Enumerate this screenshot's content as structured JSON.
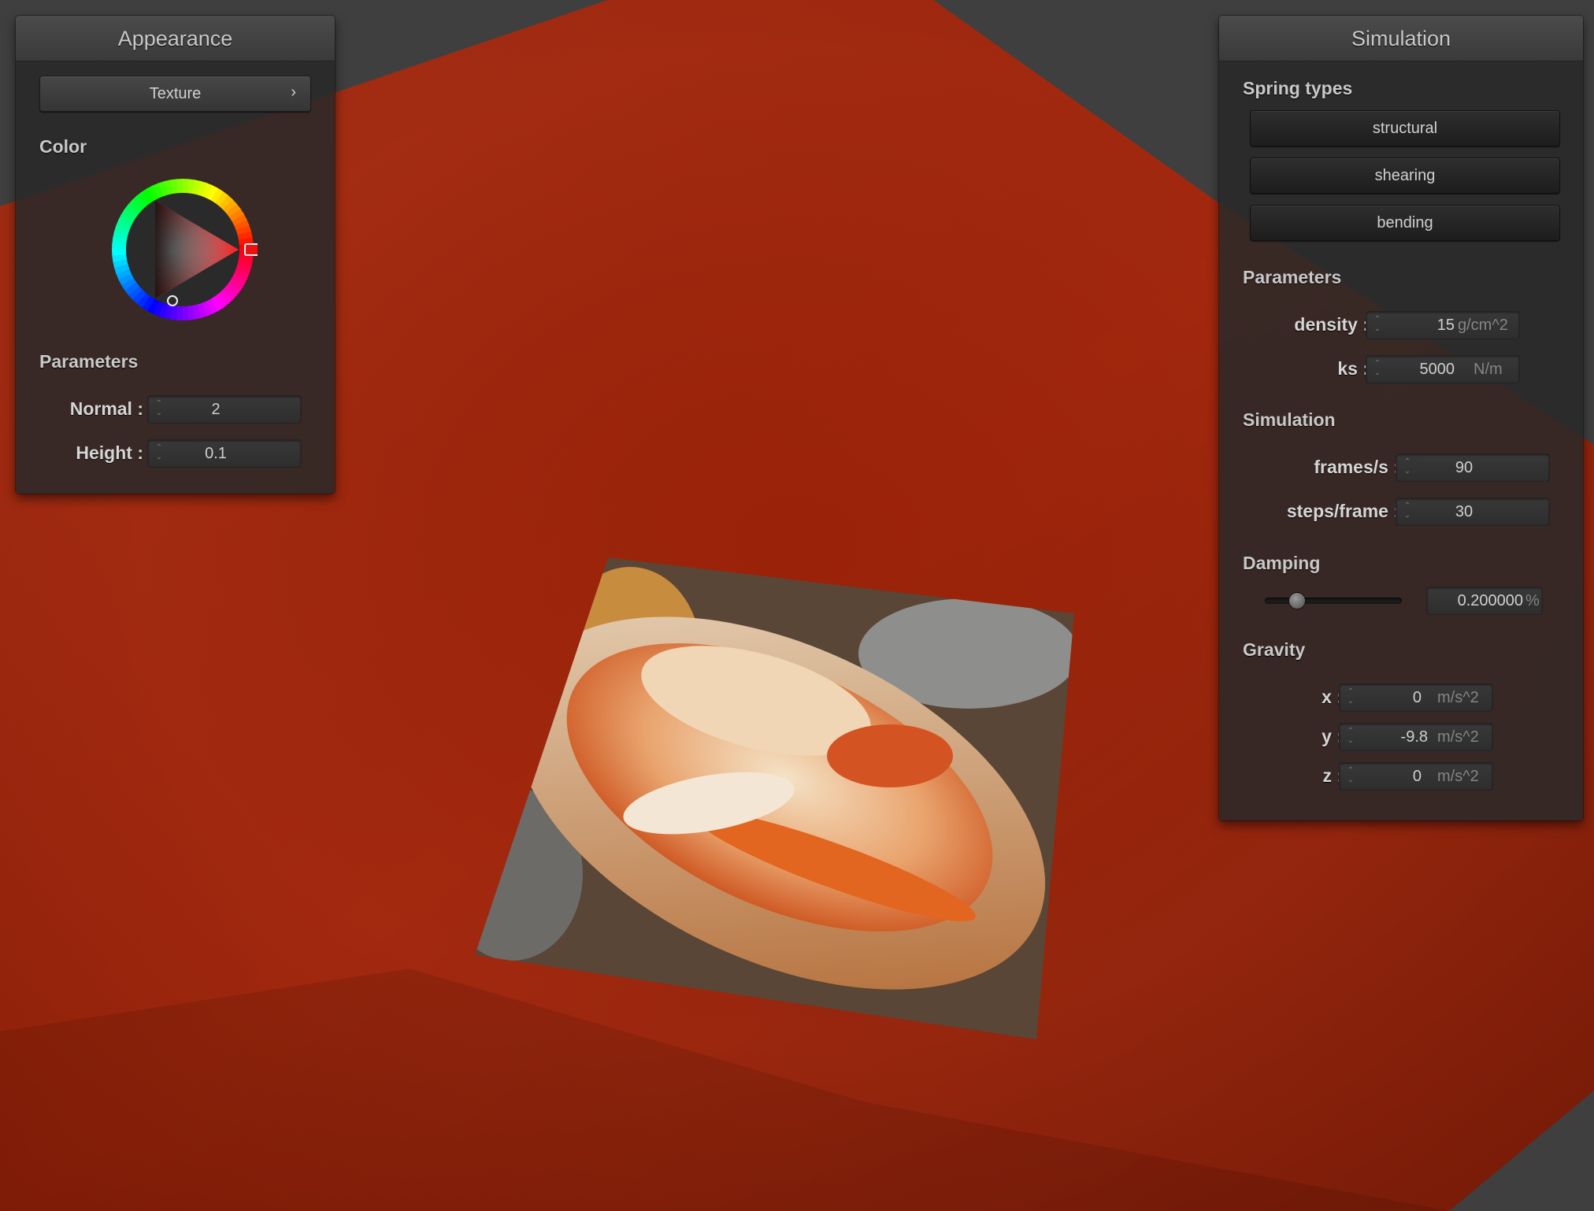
{
  "appearance": {
    "title": "Appearance",
    "texture_button": "Texture",
    "texture_chevron": "›",
    "color_label": "Color",
    "color_value": "#ff0000",
    "parameters_label": "Parameters",
    "normal_label": "Normal :",
    "normal_value": "2",
    "height_label": "Height :",
    "height_value": "0.1"
  },
  "simulation": {
    "title": "Simulation",
    "spring_types_label": "Spring types",
    "spring_buttons": [
      "structural",
      "shearing",
      "bending"
    ],
    "parameters_label": "Parameters",
    "density_label": "density :",
    "density_value": "15",
    "density_unit": "g/cm^2",
    "ks_label": "ks :",
    "ks_value": "5000",
    "ks_unit": "N/m",
    "simulation_label": "Simulation",
    "fps_label": "frames/s :",
    "fps_value": "90",
    "steps_label": "steps/frame :",
    "steps_value": "30",
    "damping_label": "Damping",
    "damping_value": "0.200000",
    "damping_unit": "%",
    "damping_fraction": 0.2,
    "gravity_label": "Gravity",
    "gx_label": "x :",
    "gx_value": "0",
    "gy_label": "y :",
    "gy_value": "-9.8",
    "gz_label": "z :",
    "gz_value": "0",
    "gravity_unit": "m/s^2"
  },
  "colors": {
    "cloth": "#a0270f",
    "floor": "#3d3d3d",
    "panel_bg": "#2a2929"
  }
}
